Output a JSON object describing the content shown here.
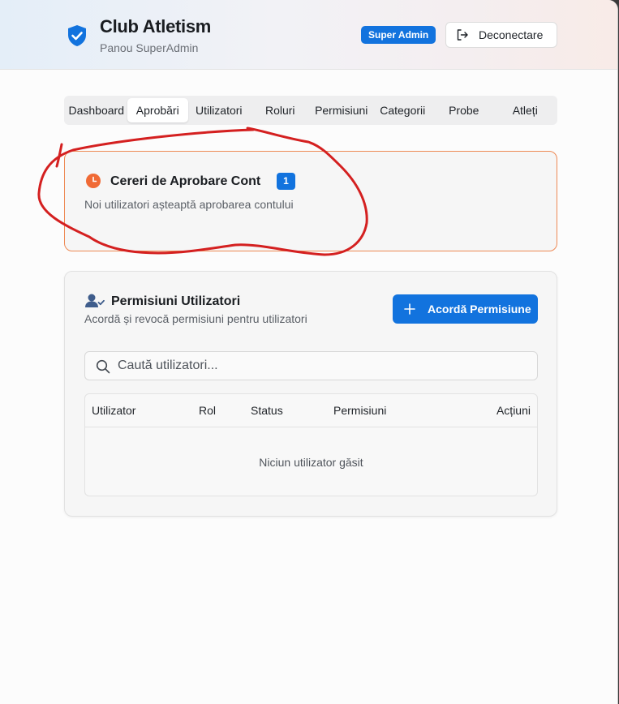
{
  "header": {
    "title": "Club Atletism",
    "subtitle": "Panou SuperAdmin",
    "role_badge": "Super Admin",
    "logout_label": "Deconectare"
  },
  "tabs": [
    {
      "label": "Dashboard",
      "active": false
    },
    {
      "label": "Aprobări",
      "active": true
    },
    {
      "label": "Utilizatori",
      "active": false
    },
    {
      "label": "Roluri",
      "active": false
    },
    {
      "label": "Permisiuni",
      "active": false
    },
    {
      "label": "Categorii",
      "active": false
    },
    {
      "label": "Probe",
      "active": false
    },
    {
      "label": "Atleți",
      "active": false
    }
  ],
  "approvals": {
    "title": "Cereri de Aprobare Cont",
    "count": "1",
    "description": "Noi utilizatori așteaptă aprobarea contului"
  },
  "permissions": {
    "title": "Permisiuni Utilizatori",
    "description": "Acordă și revocă permisiuni pentru utilizatori",
    "grant_button": "Acordă Permisiune",
    "search_placeholder": "Caută utilizatori...",
    "search_value": "",
    "columns": [
      "Utilizator",
      "Rol",
      "Status",
      "Permisiuni",
      "Acțiuni"
    ],
    "rows": [],
    "empty_message": "Niciun utilizator găsit"
  },
  "colors": {
    "accent": "#1273de",
    "approval_border": "#ee8a55",
    "clock_icon": "#f06a35",
    "annotation_stroke": "#d42020"
  },
  "icons": {
    "logo": "shield-check-icon",
    "logout": "logout-icon",
    "approvals": "clock-icon",
    "permissions": "user-check-icon",
    "grant": "plus-icon",
    "search": "search-icon"
  }
}
